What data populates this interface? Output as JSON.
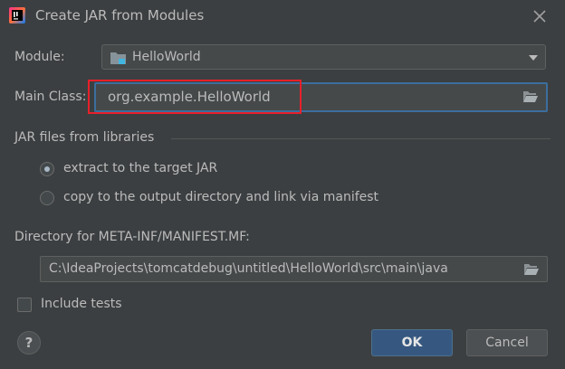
{
  "window": {
    "title": "Create JAR from Modules",
    "app_icon": "intellij-idea-icon",
    "close_icon": "close-icon"
  },
  "module": {
    "label": "Module:",
    "value": "HelloWorld",
    "icon": "module-folder-icon"
  },
  "main_class": {
    "label": "Main Class:",
    "value": "org.example.HelloWorld",
    "browse_icon": "folder-open-icon"
  },
  "jar_files": {
    "group_title": "JAR files from libraries",
    "options": [
      {
        "label": "extract to the target JAR",
        "selected": true
      },
      {
        "label": "copy to the output directory and link via manifest",
        "selected": false
      }
    ]
  },
  "manifest": {
    "label": "Directory for META-INF/MANIFEST.MF:",
    "value": "C:\\IdeaProjects\\tomcatdebug\\untitled\\HelloWorld\\src\\main\\java",
    "browse_icon": "folder-open-icon"
  },
  "include_tests": {
    "label": "Include tests",
    "checked": false
  },
  "buttons": {
    "help": "?",
    "ok": "OK",
    "cancel": "Cancel"
  },
  "colors": {
    "background": "#3c3f41",
    "accent_focus": "#3b6e9e",
    "highlight_annotation": "#e8202a",
    "primary_button": "#365880"
  }
}
